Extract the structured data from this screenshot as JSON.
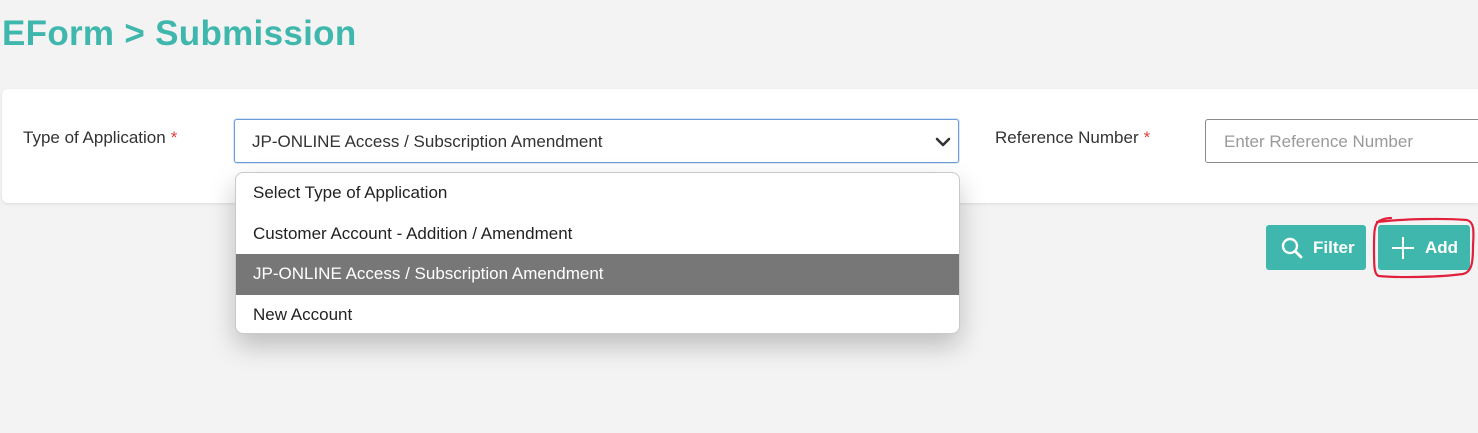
{
  "page": {
    "title": "EForm > Submission"
  },
  "filters": {
    "type_of_application": {
      "label": "Type of Application",
      "required_marker": "*",
      "selected_value": "JP-ONLINE Access / Subscription Amendment",
      "options": [
        "Select Type of Application",
        "Customer Account - Addition / Amendment",
        "JP-ONLINE Access / Subscription Amendment",
        "New Account"
      ],
      "selected_index": 2
    },
    "reference_number": {
      "label": "Reference Number",
      "required_marker": "*",
      "placeholder": "Enter Reference Number",
      "value": ""
    }
  },
  "actions": {
    "filter_label": "Filter",
    "filter_icon": "search-icon",
    "add_label": "Add",
    "add_icon": "plus-icon"
  },
  "colors": {
    "accent": "#3fb7ad",
    "required": "#e03e3e",
    "selected_option_bg": "#777777",
    "annotation": "#e0203c"
  }
}
